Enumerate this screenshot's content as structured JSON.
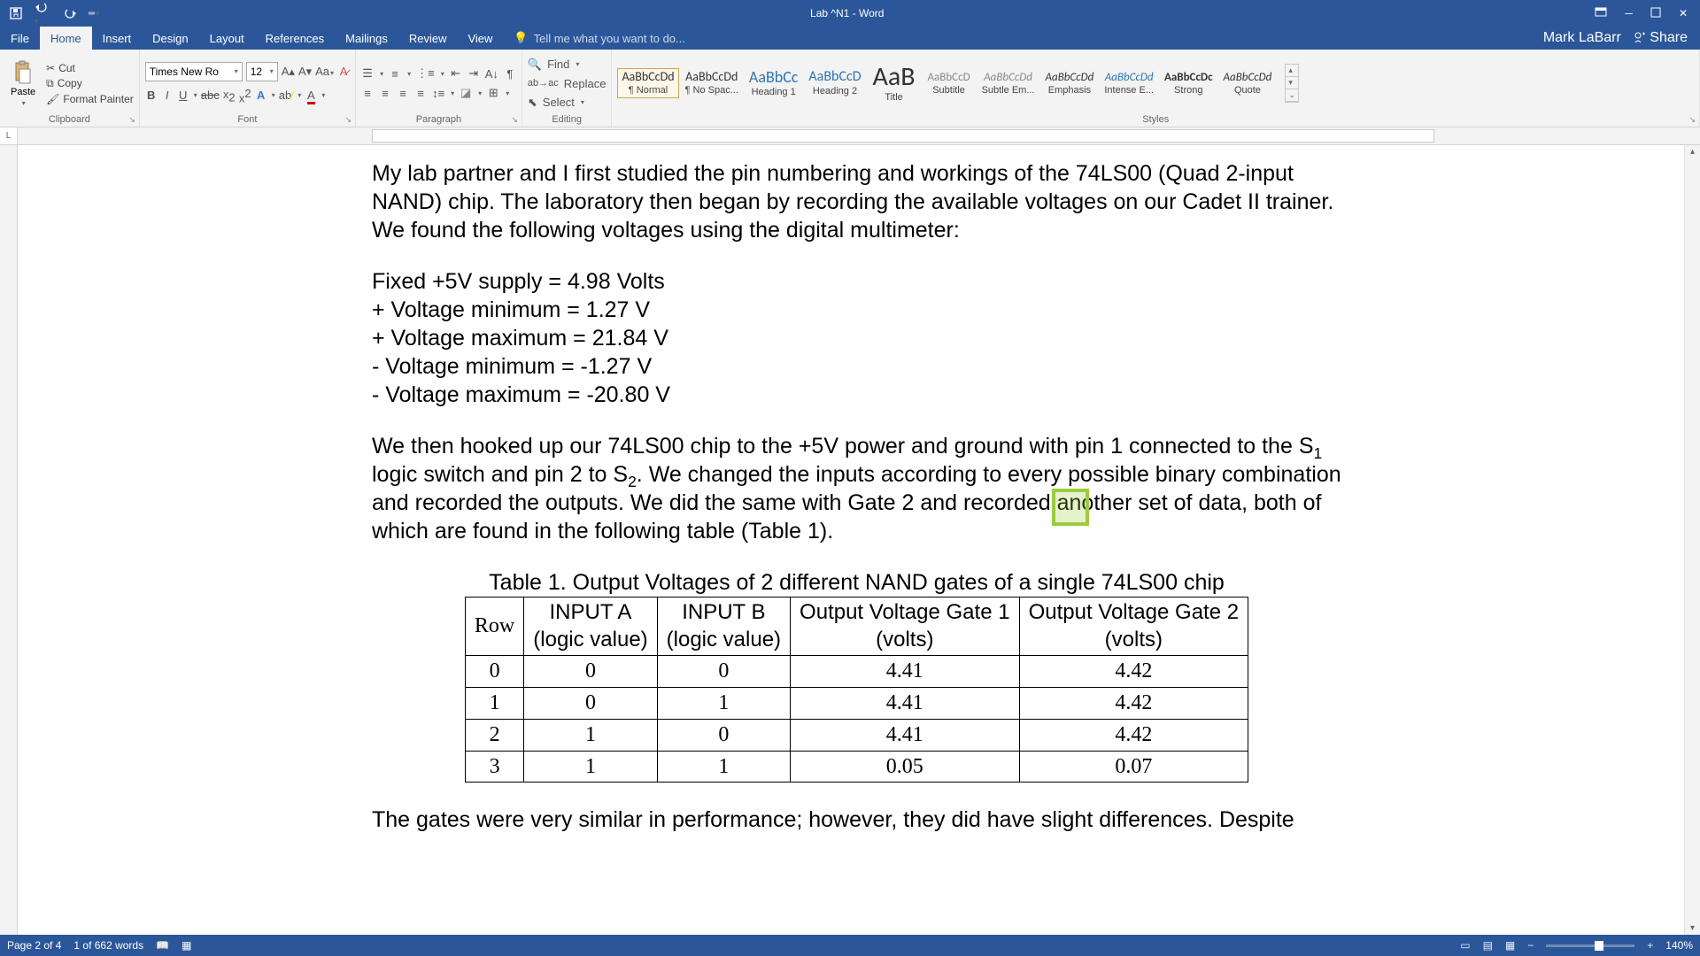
{
  "title": "Lab ^N1 - Word",
  "user": "Mark LaBarr",
  "share": "Share",
  "tabs": [
    "File",
    "Home",
    "Insert",
    "Design",
    "Layout",
    "References",
    "Mailings",
    "Review",
    "View"
  ],
  "tellme": "Tell me what you want to do...",
  "clipboard": {
    "paste": "Paste",
    "cut": "Cut",
    "copy": "Copy",
    "fmt": "Format Painter",
    "label": "Clipboard"
  },
  "font": {
    "name": "Times New Ro",
    "size": "12",
    "label": "Font"
  },
  "paragraph": {
    "label": "Paragraph"
  },
  "editing": {
    "find": "Find",
    "replace": "Replace",
    "select": "Select",
    "label": "Editing"
  },
  "styles": {
    "label": "Styles",
    "items": [
      {
        "prev": "AaBbCcDd",
        "name": "¶ Normal",
        "sz": 14,
        "col": "#333",
        "sel": true
      },
      {
        "prev": "AaBbCcDd",
        "name": "¶ No Spac...",
        "sz": 14,
        "col": "#333"
      },
      {
        "prev": "AaBbCc",
        "name": "Heading 1",
        "sz": 18,
        "col": "#2e74b5"
      },
      {
        "prev": "AaBbCcD",
        "name": "Heading 2",
        "sz": 16,
        "col": "#2e74b5"
      },
      {
        "prev": "AaB",
        "name": "Title",
        "sz": 30,
        "col": "#333"
      },
      {
        "prev": "AaBbCcD",
        "name": "Subtitle",
        "sz": 13,
        "col": "#888"
      },
      {
        "prev": "AaBbCcDd",
        "name": "Subtle Em...",
        "sz": 13,
        "col": "#888",
        "it": true
      },
      {
        "prev": "AaBbCcDd",
        "name": "Emphasis",
        "sz": 13,
        "col": "#333",
        "it": true
      },
      {
        "prev": "AaBbCcDd",
        "name": "Intense E...",
        "sz": 13,
        "col": "#2e74b5",
        "it": true
      },
      {
        "prev": "AaBbCcDc",
        "name": "Strong",
        "sz": 13,
        "col": "#333",
        "bold": true
      },
      {
        "prev": "AaBbCcDd",
        "name": "Quote",
        "sz": 13,
        "col": "#333",
        "it": true
      }
    ]
  },
  "document": {
    "p1": "My lab partner and I first studied the pin numbering and workings of the 74LS00 (Quad 2-input NAND) chip. The laboratory then began by recording the available voltages on our Cadet II trainer. We found the following voltages using the digital multimeter:",
    "v1": "Fixed +5V supply = 4.98 Volts",
    "v2": "+ Voltage minimum = 1.27 V",
    "v3": "+ Voltage maximum = 21.84 V",
    "v4": "- Voltage minimum = -1.27 V",
    "v5": "- Voltage maximum = -20.80 V",
    "p2a": "We then hooked up our 74LS00 chip to the +5V power and ground with pin 1 connected to the S",
    "p2b": " logic switch and pin 2 to S",
    "p2c": ". We changed the inputs according to every possible binary combination and recorded the outputs. We did the same with Gate 2 and recorded another set of data, both of which are found in the following table (Table 1).",
    "caption": "Table 1. Output Voltages of 2 different NAND gates of a single 74LS00 chip",
    "table": {
      "h": [
        "Row",
        "INPUT A",
        "INPUT B",
        "Output Voltage Gate 1",
        "Output Voltage Gate 2"
      ],
      "h2": [
        "",
        "(logic value)",
        "(logic value)",
        "(volts)",
        "(volts)"
      ],
      "rows": [
        [
          "0",
          "0",
          "0",
          "4.41",
          "4.42"
        ],
        [
          "1",
          "0",
          "1",
          "4.41",
          "4.42"
        ],
        [
          "2",
          "1",
          "0",
          "4.41",
          "4.42"
        ],
        [
          "3",
          "1",
          "1",
          "0.05",
          "0.07"
        ]
      ]
    },
    "p3": "The gates were very similar in performance; however, they did have slight differences. Despite"
  },
  "status": {
    "page": "Page 2 of 4",
    "words": "1 of 662 words",
    "zoom": "140%"
  }
}
